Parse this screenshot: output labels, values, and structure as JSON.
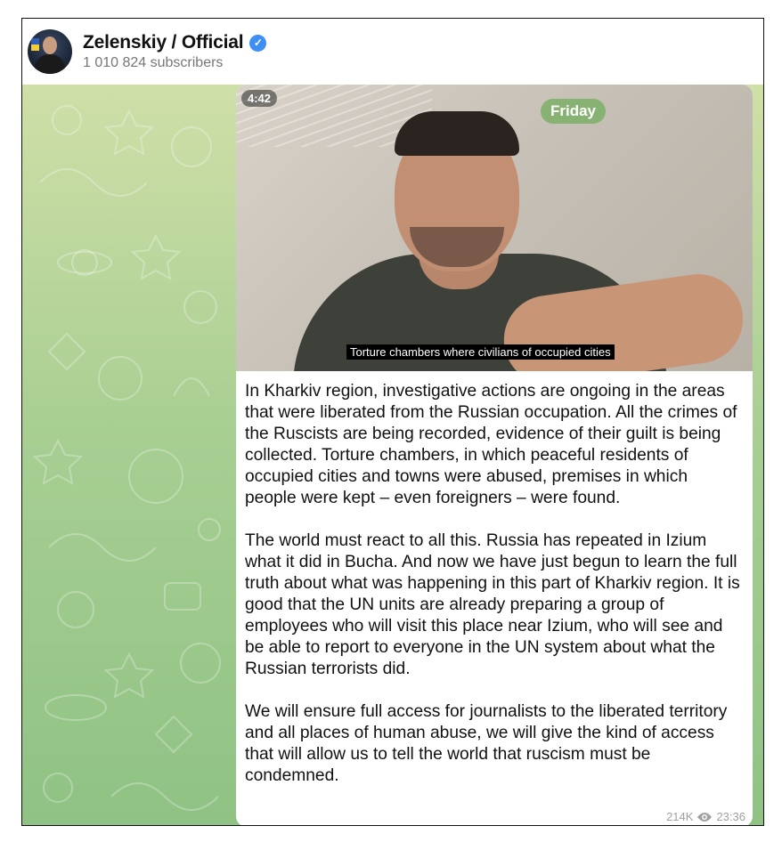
{
  "channel": {
    "name": "Zelenskiy / Official",
    "verified_icon": "verified-check-icon",
    "subscribers": "1 010 824 subscribers"
  },
  "post": {
    "video": {
      "duration": "4:42",
      "subtitle": "Torture chambers where civilians of occupied cities"
    },
    "date_badge": "Friday",
    "paragraphs": [
      "In Kharkiv region, investigative actions are ongoing in the areas that were liberated from the Russian occupation. All the crimes of the Ruscists are being recorded, evidence of their guilt is being collected. Torture chambers, in which peaceful residents of occupied cities and towns were abused, premises in which people were kept – even foreigners – were found.",
      "The world must react to all this. Russia has repeated in Izium what it did in Bucha. And now we have just begun to learn the full truth about what was happening in this part of Kharkiv region. It is good that the UN units are already preparing a group of employees who will visit this place near Izium, who will see and be able to report to everyone in the UN system about what the Russian terrorists did.",
      "We will ensure full access for journalists to the liberated territory and all places of human abuse, we will give the kind of access that will allow us to tell the world that ruscism must be condemned."
    ],
    "views": "214K",
    "time": "23:36"
  },
  "colors": {
    "verified": "#3d8ff4",
    "date_badge": "#88b274",
    "chat_background_top": "#cfdfa8",
    "chat_background_bottom": "#8fc284",
    "meta_text": "#a0a0a0"
  }
}
